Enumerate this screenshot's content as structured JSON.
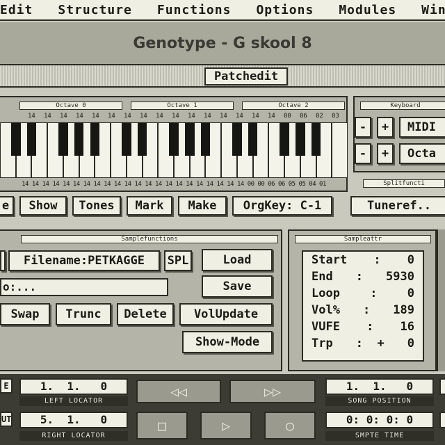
{
  "menu": [
    "Edit",
    "Structure",
    "Functions",
    "Options",
    "Modules",
    "Windo"
  ],
  "banner_title": "Genotype - G skool 8",
  "window_title": "Patchedit",
  "octaves": [
    "Octave 0",
    "Octave 1",
    "Octave 2"
  ],
  "keyboard_header": "Keyboard",
  "split_header": "Splitfuncti",
  "key_numbers_top": [
    "14",
    "14",
    "14",
    "14",
    "14",
    "14",
    "14",
    "14",
    "14",
    "14",
    "14",
    "14",
    "14",
    "14",
    "14",
    "14",
    "00",
    "06",
    "02",
    "03"
  ],
  "key_numbers_bottom": "14 14 14 14 14 14 14 14 14 14 14 14 14 14 14 14 14 14 14 14 14 14 00 00 06 06 05 05 04 01",
  "keyboard_buttons": {
    "minus": "-",
    "plus": "+",
    "midi": "MIDI",
    "octave": "Octa"
  },
  "toolbar": {
    "e": "e",
    "show": "Show",
    "tones": "Tones",
    "mark": "Mark",
    "make": "Make",
    "orgkey": "OrgKey: C-1",
    "tuneref": "Tuneref.."
  },
  "sample_functions": {
    "header": "Samplefunctions",
    "filename": "Filename:PETKAGGE",
    "spl": "SPL",
    "load": "Load",
    "save": "Save",
    "path": "o:...",
    "swap": "Swap",
    "trunc": "Trunc",
    "delete": "Delete",
    "volupdate": "VolUpdate",
    "showmode": "Show-Mode"
  },
  "sample_attr": {
    "header": "Sampleattr",
    "rows": [
      {
        "label": "Start",
        "sep": ":",
        "value": "0"
      },
      {
        "label": "End",
        "sep": ":",
        "value": "5930"
      },
      {
        "label": "Loop",
        "sep": ":",
        "value": "0"
      },
      {
        "label": "Vol%",
        "sep": ":",
        "value": "189"
      },
      {
        "label": "VUFE",
        "sep": ":",
        "value": "16"
      },
      {
        "label": "Trp",
        "sep": ":  +",
        "value": "0"
      }
    ]
  },
  "transport": {
    "left_locator_value": "1.  1.   0",
    "left_locator_label": "LEFT LOCATOR",
    "right_locator_value": "5.  1.   0",
    "right_locator_label": "RIGHT LOCATOR",
    "song_position_value": "1.  1.   0",
    "song_position_label": "SONG POSITION",
    "smpte_value": "0: 0: 0: 0",
    "smpte_label": "SMPTE TIME",
    "left_edge_top": "E",
    "left_edge_bottom": "UT",
    "rewind": "◁◁",
    "forward": "▷▷",
    "stop": "□",
    "play": "▷",
    "record": "○"
  }
}
